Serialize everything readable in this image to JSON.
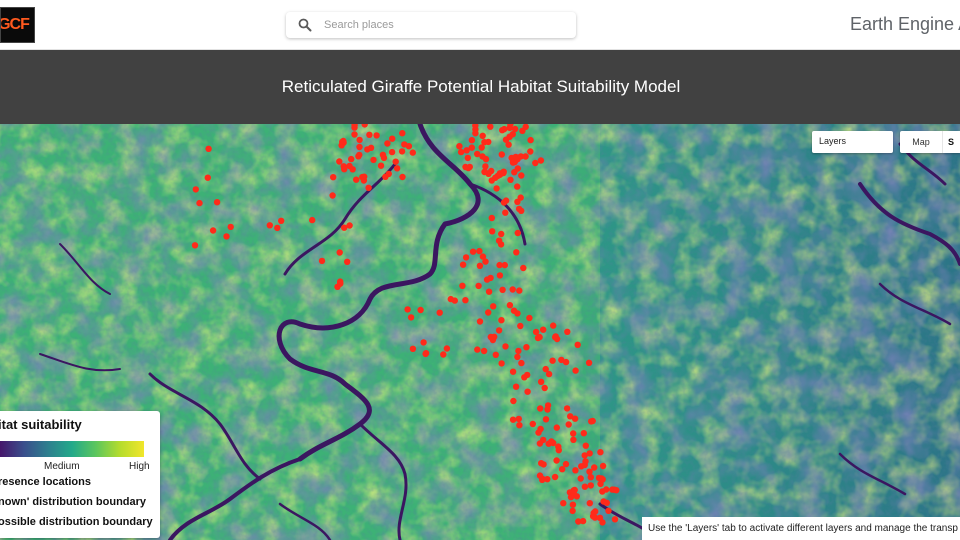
{
  "app": {
    "title": "Earth Engine A",
    "logo_text": "GCF"
  },
  "search": {
    "placeholder": "Search places",
    "icon": "search-icon"
  },
  "page": {
    "title": "Reticulated Giraffe Potential Habitat Suitability Model"
  },
  "map_controls": {
    "layers_label": "Layers",
    "map_button": "Map",
    "satellite_button": "S"
  },
  "legend": {
    "title": "itat suitability",
    "medium_label": "Medium",
    "high_label": "High",
    "items": [
      "resence locations",
      "nown' distribution boundary",
      "ossible distribution boundary"
    ],
    "gradient_colors": [
      "#46166b",
      "#3a4f8c",
      "#2d7f8e",
      "#23a98a",
      "#5cc65d",
      "#b5dc2d",
      "#f1e62b"
    ],
    "presence_color": "#ff2a1a"
  },
  "info": {
    "text": "Use the 'Layers' tab to activate different layers and manage the transp"
  },
  "colors": {
    "header_band": "#414141",
    "presence_points": "#ff2a1a",
    "river_channel": "#3b1660"
  }
}
